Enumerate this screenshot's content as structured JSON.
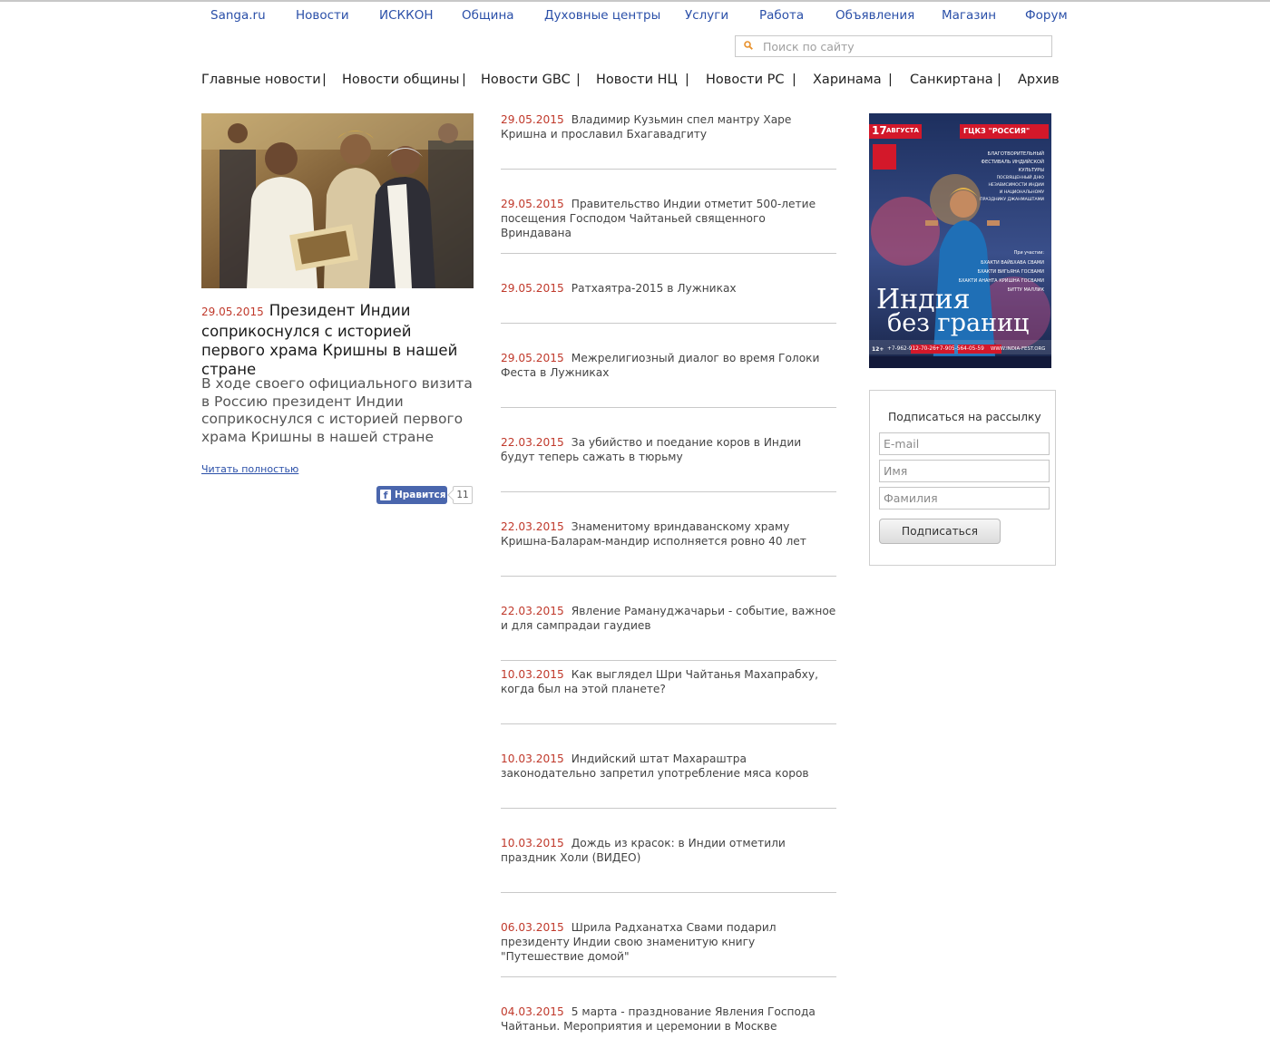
{
  "top_nav": [
    "Sanga.ru",
    "Новости",
    "ИСККОН",
    "Община",
    "Духовные центры",
    "Услуги",
    "Работа",
    "Объявления",
    "Магазин",
    "Форум"
  ],
  "search": {
    "placeholder": "Поиск по сайту",
    "icon": "search-icon"
  },
  "sub_nav": [
    "Главные новости",
    "Новости общины",
    "Новости GBC",
    "Новости НЦ",
    "Новости РС",
    "Харинама",
    "Санкиртана",
    "Архив"
  ],
  "sub_nav_separator": "|",
  "featured": {
    "date": "29.05.2015",
    "title": "Президент Индии соприкоснулся с историей первого храма Кришны в нашей стране",
    "lead": "В ходе своего официального визита в Россию президент Индии соприкоснулся с историей первого храма Кришны в нашей стране",
    "read_more": "Читать полностью",
    "like_label": "Нравится",
    "like_count": "11"
  },
  "news": [
    {
      "date": "29.05.2015",
      "title": "Владимир Кузьмин спел мантру Харе Кришна и прославил Бхагавадгиту"
    },
    {
      "date": "29.05.2015",
      "title": "Правительство Индии отметит 500-летие посещения Господом Чайтаньей священного Вриндавана"
    },
    {
      "date": "29.05.2015",
      "title": "Ратхаятра-2015 в Лужниках"
    },
    {
      "date": "29.05.2015",
      "title": "Межрелигиозный диалог во время Голоки Феста в Лужниках"
    },
    {
      "date": "22.03.2015",
      "title": "За убийство и поедание коров в Индии будут теперь сажать в тюрьму"
    },
    {
      "date": "22.03.2015",
      "title": "Знаменитому вриндаванскому храму Кришна-Баларам-мандир исполняется ровно 40 лет"
    },
    {
      "date": "22.03.2015",
      "title": "Явление Рамануджачарьи - событие, важное и для сампрадаи гаудиев"
    },
    {
      "date": "10.03.2015",
      "title": "Как выглядел Шри Чайтанья Махапрабху, когда был на этой планете?"
    },
    {
      "date": "10.03.2015",
      "title": "Индийский штат Махараштра законодательно запретил употребление мяса коров"
    },
    {
      "date": "10.03.2015",
      "title": "Дождь из красок: в Индии отметили праздник Холи (ВИДЕО)"
    },
    {
      "date": "06.03.2015",
      "title": "Шрила Радханатха Свами подарил президенту Индии свою знаменитую книгу \"Путешествие домой\""
    },
    {
      "date": "04.03.2015",
      "title": "5 марта - празднование Явления Господа Чайтаньи. Мероприятия и церемонии в Москве"
    }
  ],
  "banner": {
    "date_day": "17",
    "date_month": "АВГУСТА",
    "venue": "ГЦКЗ \"РОССИЯ\"",
    "festival_lines": [
      "БЛАГОТВОРИТЕЛЬНЫЙ",
      "ФЕСТИВАЛЬ ИНДИЙСКОЙ",
      "КУЛЬТУРЫ",
      "ПОСВЯЩЕННЫЙ ДНЮ",
      "НЕЗАВИСИМОСТИ ИНДИИ",
      "И НАЦИОНАЛЬНОМУ",
      "ПРАЗДНИКУ ДЖАНМАШТАМИ"
    ],
    "guests_label": "При участии:",
    "guests": [
      "БХАКТИ ВАЙБХАВА СВАМИ",
      "БХАКТИ ВИГЬЯНА ГОСВАМИ",
      "БХАКТИ АНАНТА КРИШНА ГОСВАМИ",
      "БИТТУ МАЛЛИК"
    ],
    "title_line1": "Индия",
    "title_line2": "без границ",
    "age": "12+",
    "phone1": "+7-962-912-70-26",
    "phone2": "+7-905-564-05-59",
    "site": "WWW.INDIA-FEST.ORG"
  },
  "subscribe": {
    "title": "Подписаться на рассылку",
    "email_placeholder": "E-mail",
    "name_placeholder": "Имя",
    "surname_placeholder": "Фамилия",
    "button": "Подписаться"
  },
  "colors": {
    "link": "#2a4fa8",
    "date": "#c0392b",
    "separator": "#c9c9c9"
  }
}
